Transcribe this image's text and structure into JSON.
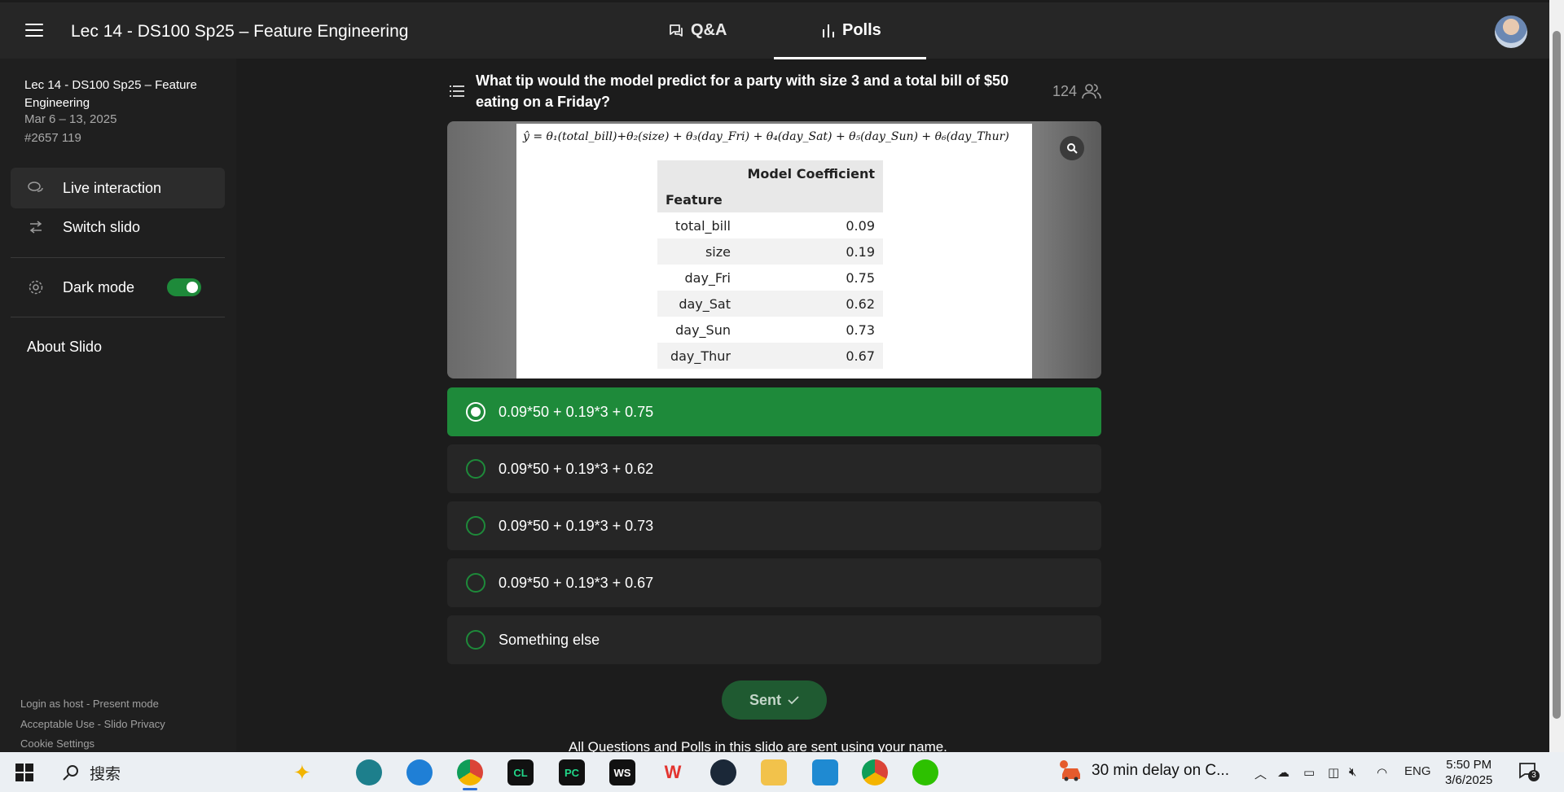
{
  "header": {
    "event_title": "Lec 14 - DS100 Sp25 – Feature Engineering",
    "tabs": [
      {
        "label": "Q&A"
      },
      {
        "label": "Polls"
      }
    ]
  },
  "sidebar": {
    "event_name": "Lec 14 - DS100 Sp25 – Feature Engineering",
    "dates": "Mar 6 – 13, 2025",
    "code": "#2657 119",
    "items": [
      {
        "label": "Live interaction",
        "icon": "chat-bubbles-icon"
      },
      {
        "label": "Switch slido",
        "icon": "switch-arrows-icon"
      }
    ],
    "dark_mode_label": "Dark mode",
    "dark_mode_on": true,
    "about_label": "About Slido",
    "footer": {
      "login": "Login as host - Present mode",
      "policy": "Acceptable Use - Slido Privacy",
      "cookies": "Cookie Settings"
    }
  },
  "poll": {
    "question": "What tip would the model predict for a party with size 3 and a total bill of $50 eating on a Friday?",
    "participants": "124",
    "formula": "ŷ = θ₁(total_bill)+θ₂(size) + θ₃(day_Fri) + θ₄(day_Sat) + θ₅(day_Sun) + θ₆(day_Thur)",
    "table": {
      "column_header": "Model Coefficient",
      "index_header": "Feature",
      "rows": [
        {
          "feature": "total_bill",
          "value": "0.09"
        },
        {
          "feature": "size",
          "value": "0.19"
        },
        {
          "feature": "day_Fri",
          "value": "0.75"
        },
        {
          "feature": "day_Sat",
          "value": "0.62"
        },
        {
          "feature": "day_Sun",
          "value": "0.73"
        },
        {
          "feature": "day_Thur",
          "value": "0.67"
        }
      ]
    },
    "options": [
      {
        "label": "0.09*50 + 0.19*3 + 0.75",
        "selected": true
      },
      {
        "label": "0.09*50 + 0.19*3 + 0.62",
        "selected": false
      },
      {
        "label": "0.09*50 + 0.19*3 + 0.73",
        "selected": false
      },
      {
        "label": "0.09*50 + 0.19*3 + 0.67",
        "selected": false
      },
      {
        "label": "Something else",
        "selected": false
      }
    ],
    "sent_label": "Sent",
    "note": "All Questions and Polls in this slido are sent using your name."
  },
  "taskbar": {
    "search_label": "搜索",
    "notification_text": "30 min delay on C...",
    "language": "ENG",
    "time": "5:50 PM",
    "date": "3/6/2025",
    "notification_count": "3"
  },
  "colors": {
    "accent": "#1e8a3a",
    "background": "#1c1c1c",
    "panel": "#262626"
  }
}
